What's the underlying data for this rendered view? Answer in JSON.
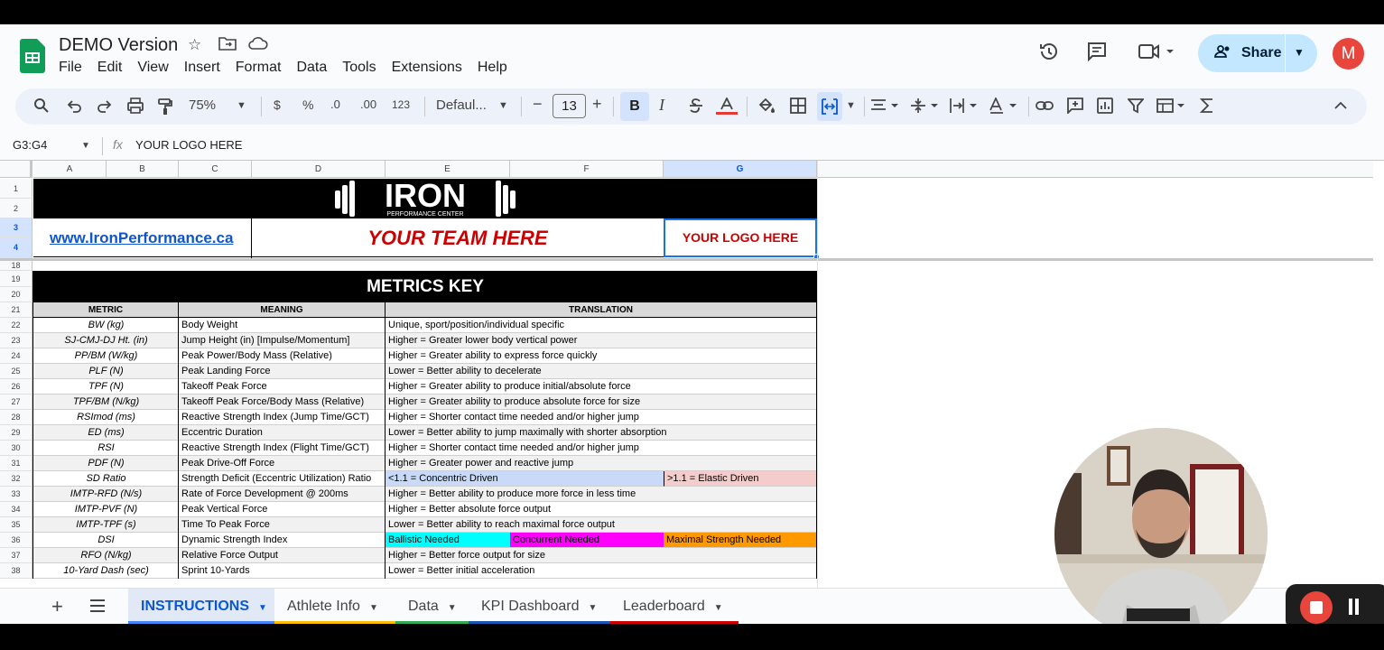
{
  "doc": {
    "title": "DEMO Version"
  },
  "menu": [
    "File",
    "Edit",
    "View",
    "Insert",
    "Format",
    "Data",
    "Tools",
    "Extensions",
    "Help"
  ],
  "header": {
    "share_label": "Share",
    "avatar_letter": "M"
  },
  "toolbar": {
    "zoom": "75%",
    "currency": "$",
    "percent": "%",
    "dec_minus": ".0",
    "dec_plus": ".00",
    "number_format": "123",
    "font": "Defaul...",
    "font_size": "13",
    "minus": "−",
    "plus": "+",
    "bold": "B",
    "italic": "I"
  },
  "formula": {
    "name_box": "G3:G4",
    "value": "YOUR LOGO HERE"
  },
  "columns": [
    "A",
    "B",
    "C",
    "D",
    "E",
    "F",
    "G"
  ],
  "rows": [
    "1",
    "2",
    "3",
    "4",
    "18",
    "19",
    "20",
    "21",
    "22",
    "23",
    "24",
    "25",
    "26",
    "27",
    "28",
    "29",
    "30",
    "31",
    "32",
    "33",
    "34",
    "35",
    "36",
    "37",
    "38"
  ],
  "sheet": {
    "website": "www.IronPerformance.ca",
    "team": "YOUR TEAM HERE",
    "logo_cell": "YOUR LOGO HERE",
    "brand_word": "IRON",
    "brand_sub": "PERFORMANCE CENTER",
    "metrics_title": "METRICS KEY",
    "headers": {
      "metric": "METRIC",
      "meaning": "MEANING",
      "translation": "TRANSLATION"
    },
    "metrics": [
      {
        "metric": "BW (kg)",
        "meaning": "Body Weight",
        "translation": "Unique, sport/position/individual specific"
      },
      {
        "metric": "SJ-CMJ-DJ Ht. (in)",
        "meaning": "Jump Height (in) [Impulse/Momentum]",
        "translation": "Higher = Greater lower body vertical power"
      },
      {
        "metric": "PP/BM (W/kg)",
        "meaning": "Peak Power/Body Mass (Relative)",
        "translation": "Higher = Greater ability to express force quickly"
      },
      {
        "metric": "PLF (N)",
        "meaning": "Peak Landing Force",
        "translation": "Lower = Better ability to decelerate"
      },
      {
        "metric": "TPF (N)",
        "meaning": "Takeoff Peak Force",
        "translation": "Higher = Greater ability to produce initial/absolute force"
      },
      {
        "metric": "TPF/BM (N/kg)",
        "meaning": "Takeoff Peak Force/Body Mass (Relative)",
        "translation": "Higher = Greater ability to produce absolute force for size"
      },
      {
        "metric": "RSImod (ms)",
        "meaning": "Reactive Strength Index (Jump Time/GCT)",
        "translation": "Higher = Shorter contact time needed and/or higher jump"
      },
      {
        "metric": "ED (ms)",
        "meaning": "Eccentric Duration",
        "translation": "Lower = Better ability to jump maximally with shorter absorption"
      },
      {
        "metric": "RSI",
        "meaning": "Reactive Strength Index (Flight Time/GCT)",
        "translation": "Higher = Shorter contact time needed and/or higher jump"
      },
      {
        "metric": "PDF (N)",
        "meaning": "Peak Drive-Off Force",
        "translation": "Higher = Greater power and reactive jump"
      },
      {
        "metric": "SD Ratio",
        "meaning": "Strength Deficit (Eccentric Utilization) Ratio",
        "translation": "<1.1 = Concentric Driven",
        "translation2": ">1.1 = Elastic Driven"
      },
      {
        "metric": "IMTP-RFD (N/s)",
        "meaning": "Rate of Force Development @ 200ms",
        "translation": "Higher = Better ability to produce more force in less time"
      },
      {
        "metric": "IMTP-PVF (N)",
        "meaning": "Peak Vertical Force",
        "translation": "Higher = Better absolute force output"
      },
      {
        "metric": "IMTP-TPF (s)",
        "meaning": "Time To Peak Force",
        "translation": "Lower = Better ability to reach maximal force output"
      },
      {
        "metric": "DSI",
        "meaning": "Dynamic Strength Index",
        "translation": "Ballistic Needed",
        "translation2": "Concurrent Needed",
        "translation3": "Maximal Strength Needed"
      },
      {
        "metric": "RFO (N/kg)",
        "meaning": "Relative Force Output",
        "translation": "Higher = Better force output for size"
      },
      {
        "metric": "10-Yard Dash (sec)",
        "meaning": "Sprint 10-Yards",
        "translation": "Lower = Better initial acceleration"
      }
    ]
  },
  "tabs": [
    {
      "label": "INSTRUCTIONS",
      "color": "#4285f4"
    },
    {
      "label": "Athlete Info",
      "color": "#fbbc04"
    },
    {
      "label": "Data",
      "color": "#34a853"
    },
    {
      "label": "KPI Dashboard",
      "color": "#1a56b0"
    },
    {
      "label": "Leaderboard",
      "color": "#cc0000"
    }
  ],
  "colors": {
    "accent": "#0b57d0",
    "share_bg": "#c2e7ff",
    "concentric": "#c9daf8",
    "elastic": "#f4cccc",
    "ballistic": "#00ffff",
    "concurrent": "#ff00ff",
    "maximal": "#ff9900"
  }
}
